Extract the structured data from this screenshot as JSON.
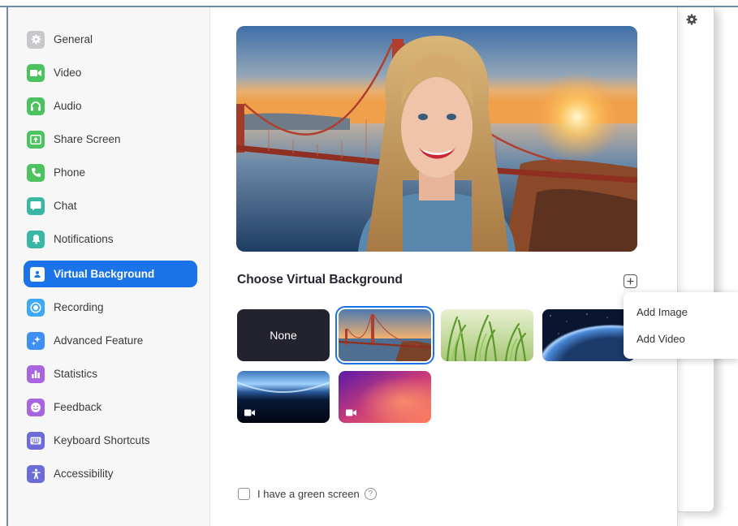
{
  "sidebar": {
    "items": [
      {
        "label": "General",
        "icon": "gear-icon",
        "color": "#c7c7cc"
      },
      {
        "label": "Video",
        "icon": "video-icon",
        "color": "#4cc35e"
      },
      {
        "label": "Audio",
        "icon": "headphones-icon",
        "color": "#4cc35e"
      },
      {
        "label": "Share Screen",
        "icon": "share-screen-icon",
        "color": "#4cc35e"
      },
      {
        "label": "Phone",
        "icon": "phone-icon",
        "color": "#4cc35e"
      },
      {
        "label": "Chat",
        "icon": "chat-icon",
        "color": "#39b7a4"
      },
      {
        "label": "Notifications",
        "icon": "bell-icon",
        "color": "#39b7a4"
      },
      {
        "label": "Virtual Background",
        "icon": "person-background-icon",
        "color": "#1a73e8",
        "active": true
      },
      {
        "label": "Recording",
        "icon": "record-icon",
        "color": "#3fa9f5"
      },
      {
        "label": "Advanced Feature",
        "icon": "sparkle-icon",
        "color": "#3f8ff5"
      },
      {
        "label": "Statistics",
        "icon": "bar-chart-icon",
        "color": "#a865e0"
      },
      {
        "label": "Feedback",
        "icon": "smiley-icon",
        "color": "#a865e0"
      },
      {
        "label": "Keyboard Shortcuts",
        "icon": "keyboard-icon",
        "color": "#6c6cd8"
      },
      {
        "label": "Accessibility",
        "icon": "accessibility-icon",
        "color": "#6c6cd8"
      }
    ]
  },
  "main": {
    "section_title": "Choose Virtual Background",
    "none_label": "None",
    "green_screen_label": "I have a green screen",
    "help_glyph": "?"
  },
  "add_menu": {
    "add_image": "Add Image",
    "add_video": "Add Video"
  },
  "colors": {
    "accent": "#1a73e8"
  }
}
